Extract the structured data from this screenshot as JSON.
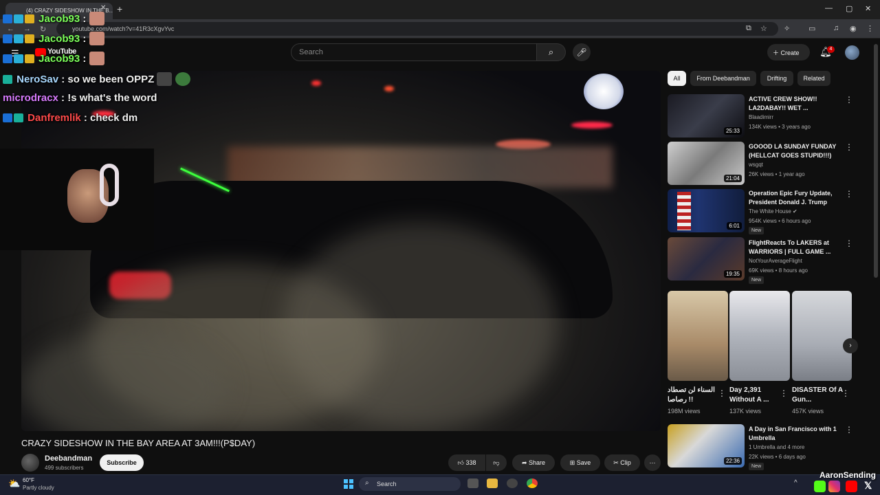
{
  "browser": {
    "tab_title": "(4) CRAZY SIDESHOW IN THE B...",
    "url": "youtube.com/watch?v=41R3cXgvYvc"
  },
  "youtube": {
    "logo": "YouTube",
    "search_placeholder": "Search",
    "create_label": "Create",
    "notifications_count": "4"
  },
  "video": {
    "title": "CRAZY SIDESHOW IN THE BAY AREA AT 3AM!!!(P$DAY)",
    "channel": "Deebandman",
    "subscribers": "499 subscribers",
    "subscribe_label": "Subscribe",
    "likes": "338",
    "share_label": "Share",
    "save_label": "Save",
    "clip_label": "Clip"
  },
  "chat": [
    {
      "user": "Jacob93",
      "message": ":",
      "color": "#7cff5a"
    },
    {
      "user": "Jacob93",
      "message": ":",
      "color": "#7cff5a"
    },
    {
      "user": "Jacob93",
      "message": ":",
      "color": "#7cff5a"
    },
    {
      "user": "NeroSav",
      "message": ": so we been OPPZ",
      "color": "#a9d8ff"
    },
    {
      "user": "microdracx",
      "message": ": !s what's the word",
      "color": "#d97cff"
    },
    {
      "user": "Danfremlik",
      "message": ": check dm",
      "color": "#ff4a4a"
    }
  ],
  "sidebar": {
    "chips": [
      "All",
      "From Deebandman",
      "Drifting",
      "Related"
    ],
    "recommendations": [
      {
        "title": "ACTIVE CREW SHOW!! LA2DABAY!! WET ...",
        "channel": "Blaadimirr",
        "meta": "134K views • 3 years ago",
        "duration": "25:33",
        "new": ""
      },
      {
        "title": "GOOOD LA SUNDAY FUNDAY (HELLCAT GOES STUPID!!!)",
        "channel": "wsgqt",
        "meta": "26K views • 1 year ago",
        "duration": "21:04",
        "new": ""
      },
      {
        "title": "Operation Epic Fury Update, President Donald J. Trump",
        "channel": "The White House",
        "meta": "954K views • 6 hours ago",
        "duration": "6:01",
        "new": "New"
      },
      {
        "title": "FlightReacts To LAKERS at WARRIORS | FULL GAME ...",
        "channel": "NotYourAverageFlight",
        "meta": "69K views • 8 hours ago",
        "duration": "19:35",
        "new": "New"
      }
    ],
    "shorts": [
      {
        "title": "السناء لن تصطاد رصاصا !!",
        "views": "198M views"
      },
      {
        "title": "Day 2,391 Without A ...",
        "views": "137K views"
      },
      {
        "title": "DISASTER Of A Gun...",
        "views": "457K views"
      }
    ],
    "bottom_rec": {
      "title": "A Day in San Francisco with 1 Umbrella",
      "channel": "1 Umbrella and 4 more",
      "meta": "22K views • 6 days ago",
      "duration": "22:36",
      "new": "New"
    }
  },
  "taskbar": {
    "temperature": "60°F",
    "weather": "Partly cloudy",
    "search_label": "Search"
  },
  "stream": {
    "streamer": "AaronSending"
  }
}
